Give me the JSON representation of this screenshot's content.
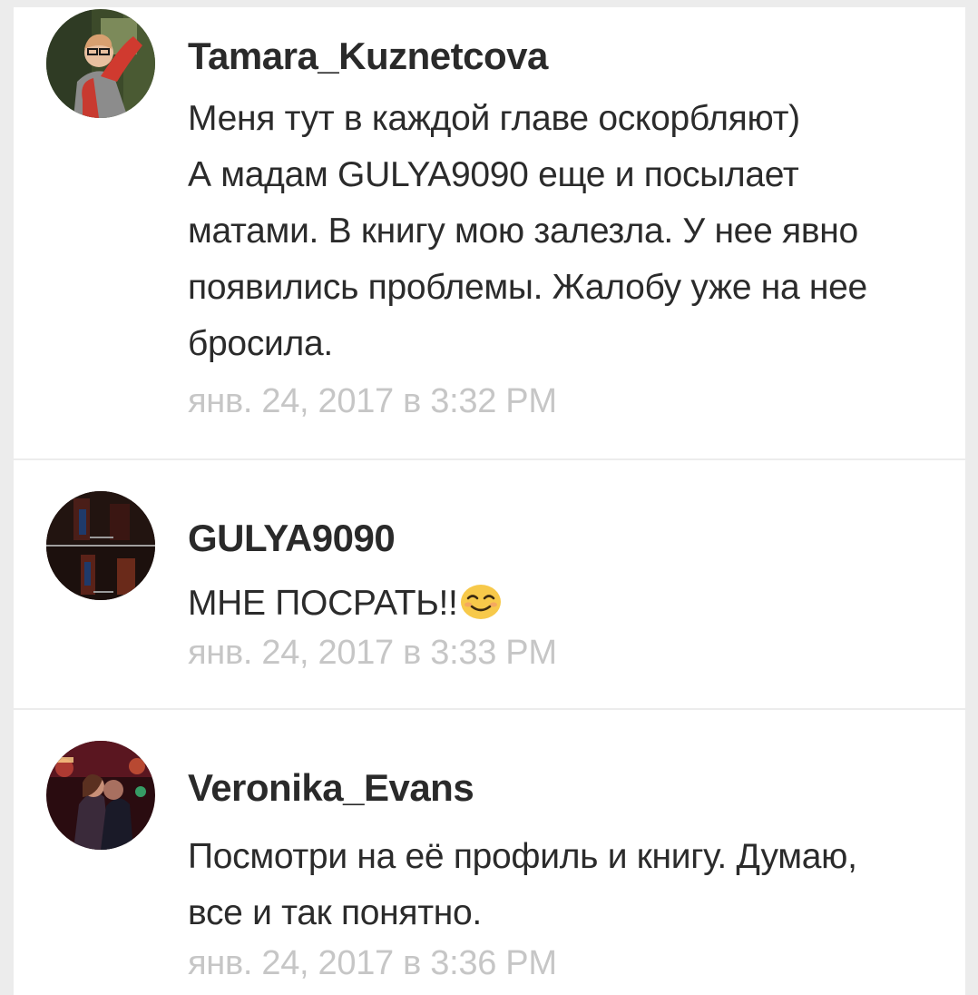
{
  "comments": [
    {
      "author": "Tamara_Kuznetcova",
      "text_lines": [
        "Меня тут в каждой главе оскорбляют)",
        "А мадам GULYA9090 еще и посылает",
        "матами. В книгу мою залезла. У нее явно",
        "появились проблемы. Жалобу уже на нее",
        "бросила."
      ],
      "time": "янв. 24, 2017 в 3:32 PM"
    },
    {
      "author": "GULYA9090",
      "text_lines": [
        "МНЕ ПОСРАТЬ!!"
      ],
      "emoji": "smiling-face-emoji",
      "time": "янв. 24, 2017 в 3:33 PM"
    },
    {
      "author": "Veronika_Evans",
      "text_lines": [
        "Посмотри на её профиль и книгу. Думаю,",
        "все и так понятно."
      ],
      "time": "янв. 24, 2017 в 3:36 PM"
    }
  ],
  "colors": {
    "background": "#ececec",
    "card": "#ffffff",
    "author": "#2a2a2a",
    "text": "#2b2b2b",
    "timestamp": "#c6c6c6",
    "emoji": "#f7c94a"
  }
}
